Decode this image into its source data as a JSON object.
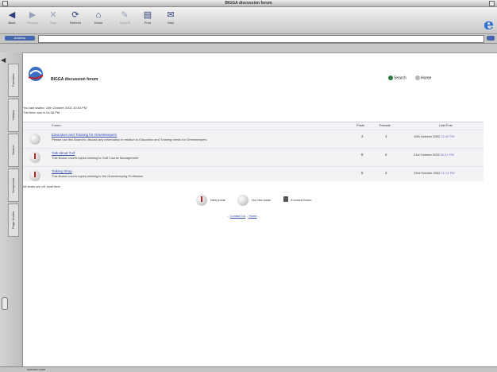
{
  "window": {
    "title": "BIGGA discussion forum"
  },
  "toolbar": {
    "buttons": [
      {
        "label": "Back",
        "icon": "back-arrow-icon"
      },
      {
        "label": "Forward",
        "icon": "forward-arrow-icon"
      },
      {
        "label": "Stop",
        "icon": "stop-icon"
      },
      {
        "label": "Refresh",
        "icon": "refresh-icon"
      },
      {
        "label": "Home",
        "icon": "home-icon"
      },
      {
        "label": "AutoFill",
        "icon": "autofill-icon"
      },
      {
        "label": "Print",
        "icon": "print-icon"
      },
      {
        "label": "Mail",
        "icon": "mail-icon"
      }
    ],
    "logo": "e"
  },
  "address": {
    "label": "Address"
  },
  "sidebar": {
    "tabs": [
      "Favorites",
      "History",
      "Search",
      "Scrapbook",
      "Page Holder"
    ]
  },
  "page": {
    "forum_title": "BIGGA discussion forum",
    "search_label": "Search",
    "home_label": "Home",
    "last_visited": "You last visited: 10th October 2002 10:53 PM",
    "time_now": "The time now is 04:38 PM",
    "columns": {
      "forum": "Forum",
      "posts": "Posts",
      "threads": "Threads",
      "last_post": "Last Post"
    },
    "forums": [
      {
        "name": "Education and Training for Greenkeepers",
        "description": "Please use this Board to discuss any information in relation to Education and Training needs for Greenkeepers",
        "posts": "2",
        "threads": "1",
        "last_post_date": "10th October 2002",
        "last_post_time": "12:42 PM",
        "new_posts": false
      },
      {
        "name": "Talk about Turf",
        "description": "This Board covers topics relating to Golf Course Management",
        "posts": "8",
        "threads": "2",
        "last_post_date": "21st October 2002",
        "last_post_time": "06:11 PM",
        "new_posts": true
      },
      {
        "name": "Talking Shop",
        "description": "This Board covers topics relating to the Greenkeeping Profession",
        "posts": "5",
        "threads": "2",
        "last_post_date": "23rd October 2002",
        "last_post_time": "01:14 PM",
        "new_posts": true
      }
    ],
    "times_note": "All times are UK local time",
    "legend": {
      "new": "New posts",
      "none": "No new posts",
      "closed": "A closed forum"
    },
    "footer": {
      "prefix": "-",
      "contact": "Contact Us",
      "sep": "-",
      "home": "Home",
      "suffix": "-"
    }
  },
  "status": {
    "text": "Internet zone"
  }
}
